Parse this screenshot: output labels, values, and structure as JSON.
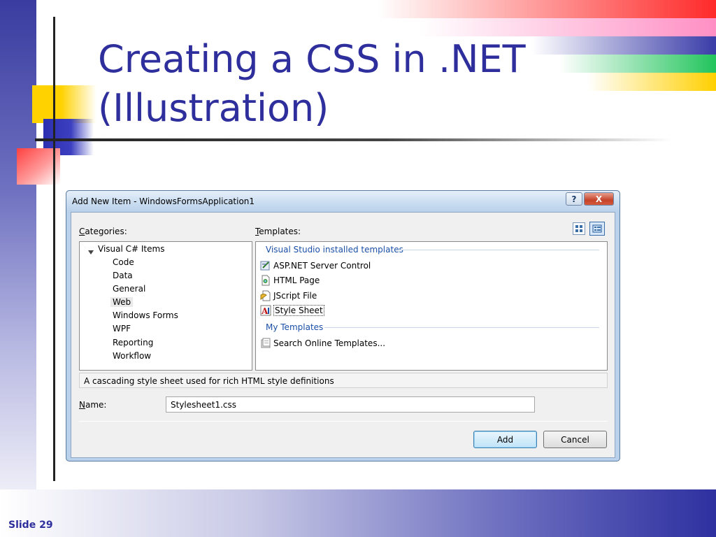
{
  "slide": {
    "title_line1": "Creating a CSS in .NET",
    "title_line2": "(Illustration)",
    "slide_number": "Slide 29"
  },
  "dialog": {
    "title": "Add New Item - WindowsFormsApplication1",
    "help_glyph": "?",
    "close_glyph": "X",
    "categories_label": {
      "hotkey": "C",
      "rest": "ategories:"
    },
    "templates_label": {
      "hotkey": "T",
      "rest": "emplates:"
    },
    "categories": {
      "root": "Visual C# Items",
      "children": [
        "Code",
        "Data",
        "General",
        "Web",
        "Windows Forms",
        "WPF",
        "Reporting",
        "Workflow"
      ],
      "selected_index": 3
    },
    "templates": {
      "groups": [
        {
          "heading": "Visual Studio installed templates",
          "items": [
            {
              "label": "ASP.NET Server Control",
              "icon": "aspnet-control-icon"
            },
            {
              "label": "HTML Page",
              "icon": "html-page-icon"
            },
            {
              "label": "JScript File",
              "icon": "jscript-file-icon"
            },
            {
              "label": "Style Sheet",
              "icon": "style-sheet-icon",
              "selected": true
            }
          ]
        },
        {
          "heading": "My Templates",
          "items": [
            {
              "label": "Search Online Templates...",
              "icon": "search-online-icon"
            }
          ]
        }
      ]
    },
    "description": "A cascading style sheet used for rich HTML style definitions",
    "name_label": {
      "hotkey": "N",
      "rest": "ame:"
    },
    "name_value": "Stylesheet1.css",
    "buttons": {
      "add": "Add",
      "cancel": "Cancel"
    },
    "view_icons": [
      "large-icons-view-icon",
      "small-icons-view-icon"
    ]
  },
  "colors": {
    "title_blue": "#2e2f9c",
    "group_heading_blue": "#1b4fa8",
    "dialog_frame": "#b9d1ea"
  }
}
